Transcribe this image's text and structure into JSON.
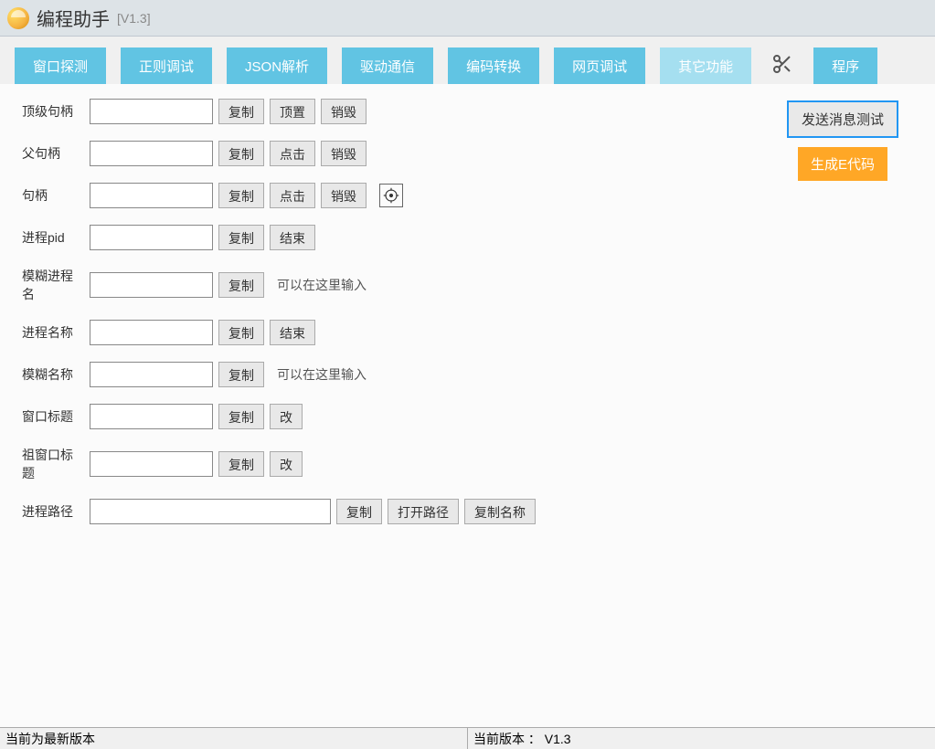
{
  "title": "编程助手",
  "version": "[V1.3]",
  "tabs": {
    "window_probe": "窗口探测",
    "regex_debug": "正则调试",
    "json_parse": "JSON解析",
    "driver_comm": "驱动通信",
    "encode_convert": "编码转换",
    "web_debug": "网页调试",
    "other_func": "其它功能",
    "program": "程序"
  },
  "labels": {
    "top_handle": "顶级句柄",
    "parent_handle": "父句柄",
    "handle": "句柄",
    "pid": "进程pid",
    "fuzzy_proc": "模糊进程名",
    "proc_name": "进程名称",
    "fuzzy_name": "模糊名称",
    "win_title": "窗口标题",
    "anc_title": "祖窗口标题",
    "proc_path": "进程路径"
  },
  "buttons": {
    "copy": "复制",
    "top": "顶置",
    "destroy": "销毁",
    "click": "点击",
    "end": "结束",
    "change": "改",
    "open_path": "打开路径",
    "copy_name": "复制名称",
    "send_msg_test": "发送消息测试",
    "gen_e_code": "生成E代码"
  },
  "hints": {
    "input_here": "可以在这里输入"
  },
  "status": {
    "left": "当前为最新版本",
    "right": "当前版本 ： V1.3"
  }
}
